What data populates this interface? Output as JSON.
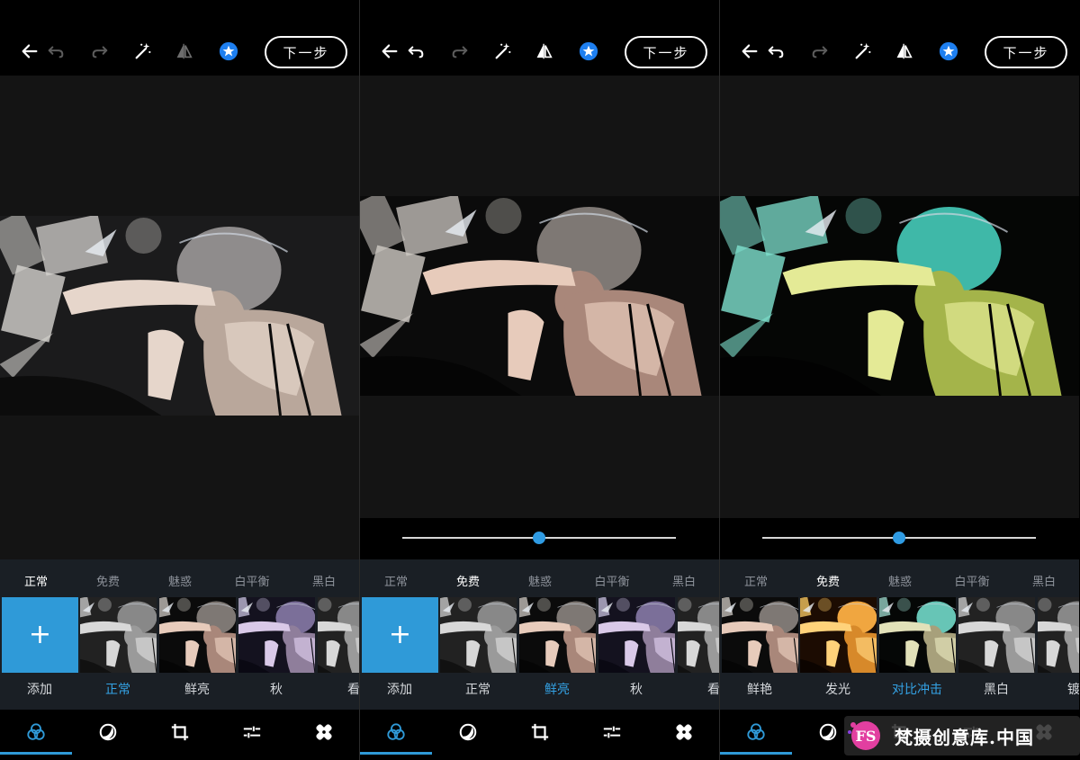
{
  "toolbar": {
    "next_label": "下一步"
  },
  "filter_tabs": [
    "正常",
    "免费",
    "魅惑",
    "白平衡",
    "黑白"
  ],
  "panels": [
    {
      "active_tab": 0,
      "thumb_labels": [
        "添加",
        "正常",
        "鲜亮",
        "秋",
        "看"
      ],
      "active_thumb": 1,
      "first_is_add": true
    },
    {
      "active_tab": 1,
      "thumb_labels": [
        "添加",
        "正常",
        "鲜亮",
        "秋",
        "看"
      ],
      "active_thumb": 2,
      "first_is_add": true,
      "slider_value": 0.5
    },
    {
      "active_tab": 1,
      "thumb_labels": [
        "鲜艳",
        "发光",
        "对比冲击",
        "黑白",
        "镀"
      ],
      "active_thumb": 2,
      "first_is_add": false,
      "slider_value": 0.5
    }
  ],
  "add_symbol": "+",
  "watermark": {
    "logo_text": "FS",
    "text": "梵摄创意库.中国"
  },
  "colors": {
    "accent": "#2f9ad8",
    "star": "#1e7ff0",
    "toolbar_bg": "#000000",
    "panel_bg": "#1a1f25"
  },
  "icons": [
    "back-arrow-icon",
    "undo-icon",
    "redo-icon",
    "magic-wand-icon",
    "compare-icon",
    "star-icon",
    "filters-icon",
    "overlay-icon",
    "crop-icon",
    "adjust-icon",
    "heal-icon"
  ]
}
